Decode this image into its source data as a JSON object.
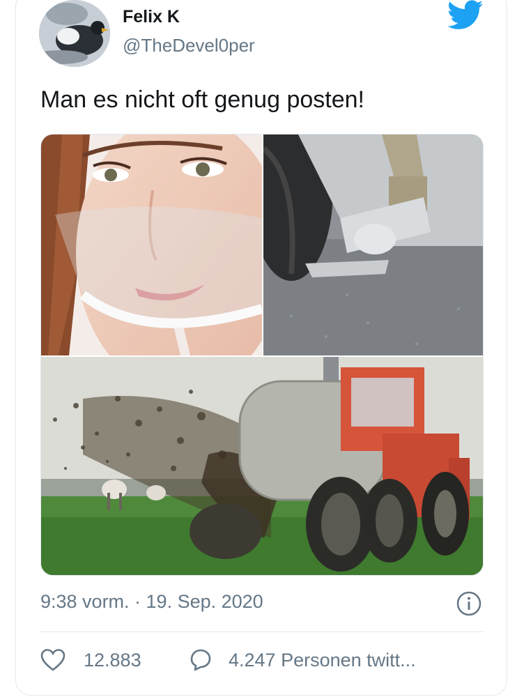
{
  "author": {
    "name": "Felix K",
    "handle": "@TheDevel0per"
  },
  "tweet": {
    "text": "Man es nicht oft genug posten!",
    "timestamp": "9:38 vorm. · 19. Sep. 2020"
  },
  "media": {
    "images": [
      "woman-face-shield-photo",
      "manure-spreader-nozzle-photo",
      "tractor-spreading-manure-photo"
    ]
  },
  "actions": {
    "likes": "12.883",
    "retweets": "4.247 Personen twitt..."
  },
  "colors": {
    "twitter_blue": "#1da1f2",
    "secondary_text": "#657786",
    "divider": "#e1e8ed"
  },
  "icons": [
    "twitter-bird-icon",
    "info-icon",
    "heart-icon",
    "comment-icon"
  ]
}
